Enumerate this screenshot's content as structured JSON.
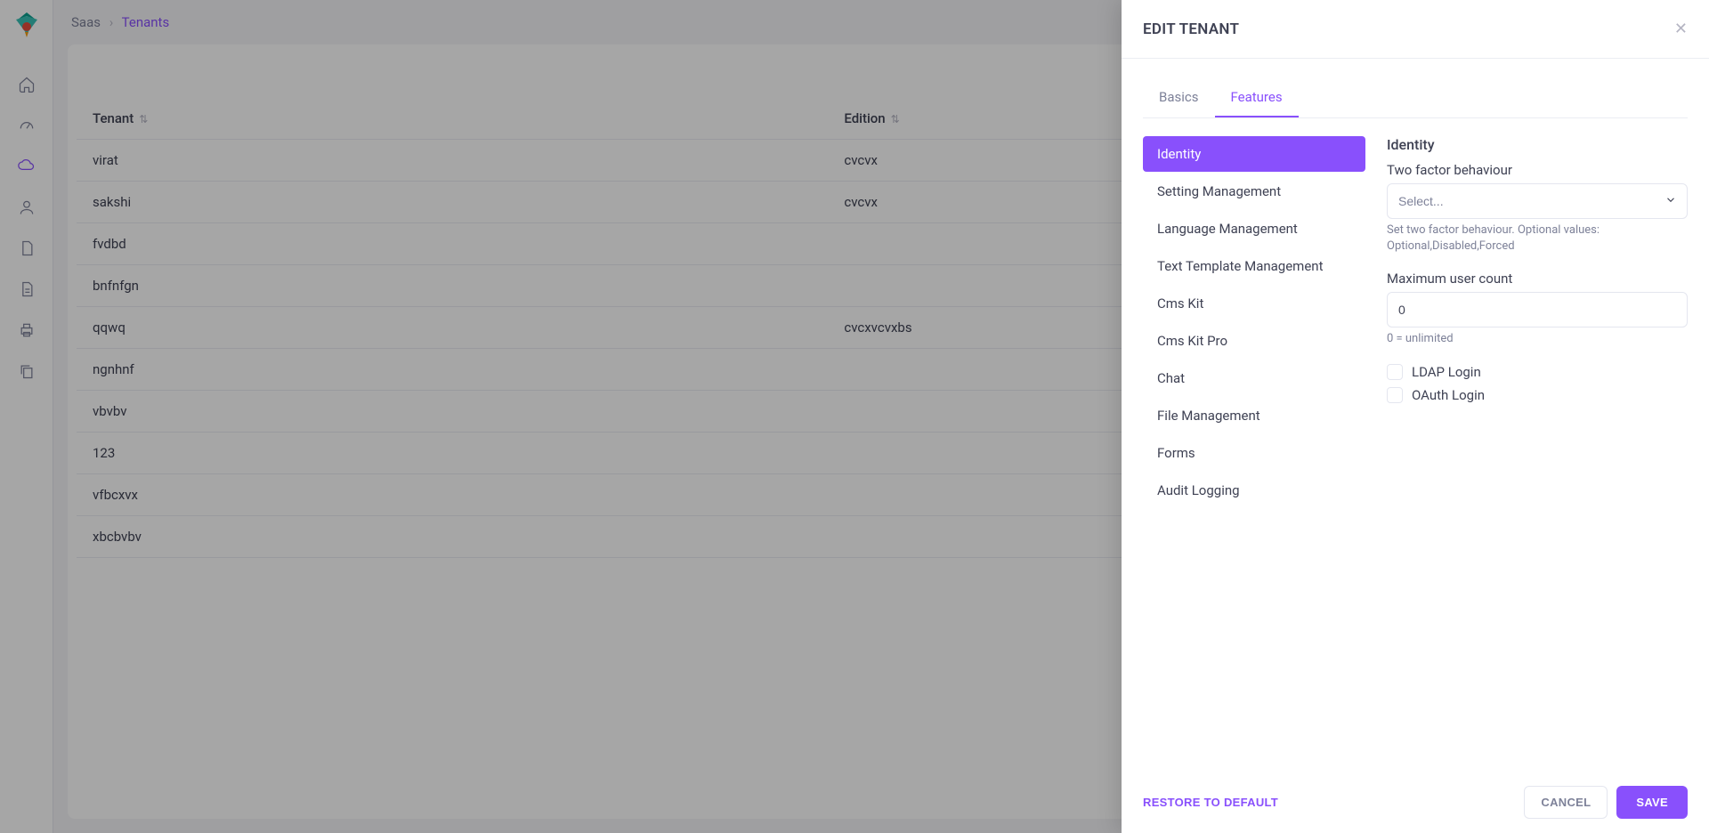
{
  "breadcrumb": {
    "root": "Saas",
    "current": "Tenants"
  },
  "table": {
    "headers": {
      "tenant": "Tenant",
      "edition": "Edition"
    },
    "rows": [
      {
        "tenant": "virat",
        "edition": "cvcvx"
      },
      {
        "tenant": "sakshi",
        "edition": "cvcvx"
      },
      {
        "tenant": "fvdbd",
        "edition": ""
      },
      {
        "tenant": "bnfnfgn",
        "edition": ""
      },
      {
        "tenant": "qqwq",
        "edition": "cvcxvcvxbs"
      },
      {
        "tenant": "ngnhnf",
        "edition": ""
      },
      {
        "tenant": "vbvbv",
        "edition": ""
      },
      {
        "tenant": "123",
        "edition": ""
      },
      {
        "tenant": "vfbcxvx",
        "edition": ""
      },
      {
        "tenant": "xbcbvbv",
        "edition": ""
      }
    ]
  },
  "drawer": {
    "title": "EDIT TENANT",
    "tabs": {
      "basics": "Basics",
      "features": "Features"
    },
    "feature_nav": [
      "Identity",
      "Setting Management",
      "Language Management",
      "Text Template Management",
      "Cms Kit",
      "Cms Kit Pro",
      "Chat",
      "File Management",
      "Forms",
      "Audit Logging"
    ],
    "content": {
      "heading": "Identity",
      "two_factor_label": "Two factor behaviour",
      "select_placeholder": "Select...",
      "two_factor_help": "Set two factor behaviour. Optional values: Optional,Disabled,Forced",
      "max_user_label": "Maximum user count",
      "max_user_value": "0",
      "max_user_help": "0 = unlimited",
      "ldap_label": "LDAP Login",
      "oauth_label": "OAuth Login"
    },
    "footer": {
      "restore": "RESTORE TO DEFAULT",
      "cancel": "CANCEL",
      "save": "SAVE"
    }
  }
}
